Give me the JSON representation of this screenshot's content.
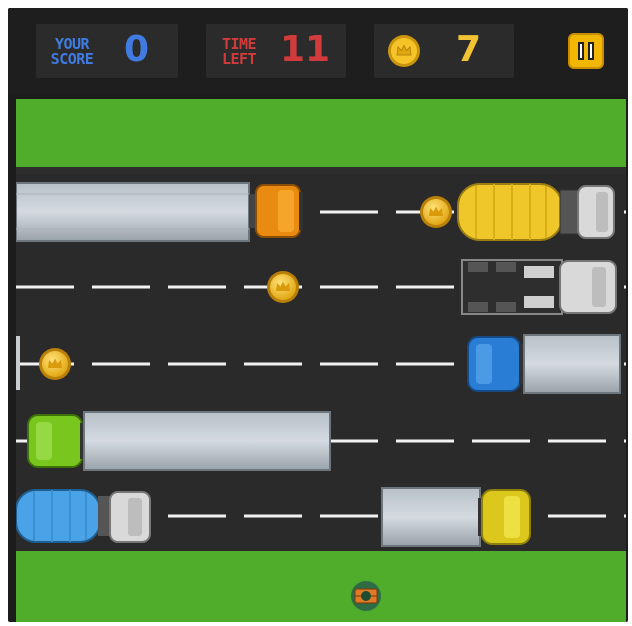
{
  "hud": {
    "score_label_1": "YOUR",
    "score_label_2": "SCORE",
    "score_value": "0",
    "time_label_1": "TIME",
    "time_label_2": "LEFT",
    "time_value": "11",
    "coins_value": "7",
    "coin_icon": "coin-icon",
    "pause_icon": "pause-icon"
  },
  "colors": {
    "score": "#3f7be0",
    "time": "#d23b3b",
    "coins": "#f1c232",
    "grass": "#4fad2b",
    "road": "#2a2a2a",
    "pause_button": "#f2b705"
  },
  "lanes": [
    {
      "vehicles": [
        "orange-truck-trailer",
        "yellow-cement-mixer"
      ],
      "coins": 1
    },
    {
      "vehicles": [
        "grey-tractor-unit"
      ],
      "coins": 1
    },
    {
      "vehicles": [
        "blue-box-truck"
      ],
      "coins": 1
    },
    {
      "vehicles": [
        "green-truck-trailer"
      ],
      "coins": 0
    },
    {
      "vehicles": [
        "blue-cement-mixer",
        "yellow-box-truck"
      ],
      "coins": 0
    }
  ],
  "player": "player-character"
}
